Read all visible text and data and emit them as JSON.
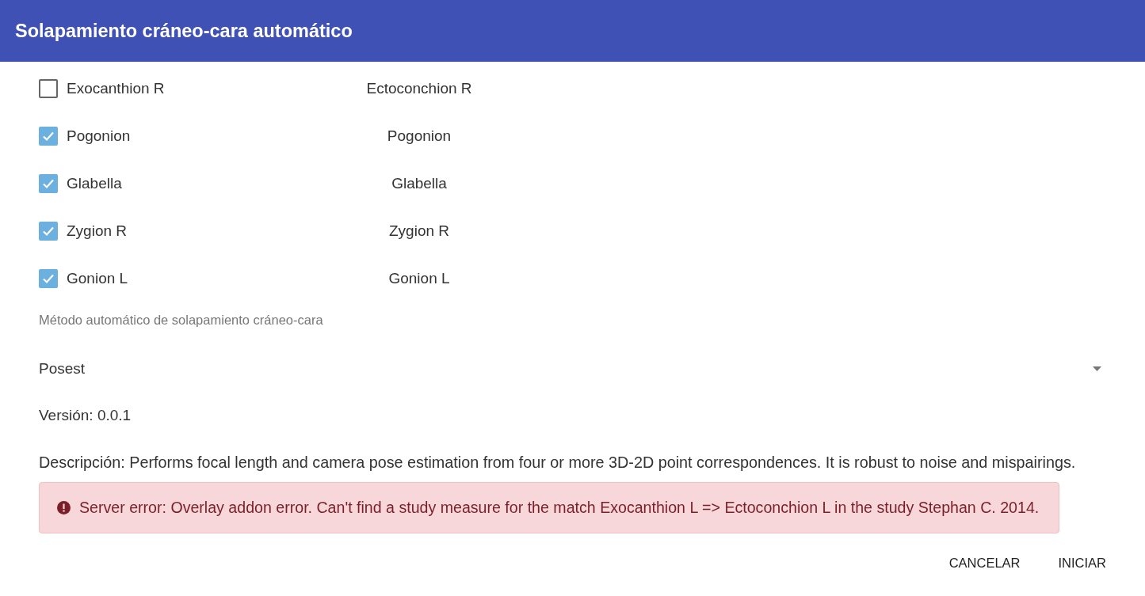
{
  "dialog": {
    "title": "Solapamiento cráneo-cara automático"
  },
  "pairs": [
    {
      "skull": "Exocanthion R",
      "face": "Ectoconchion R",
      "checked": false
    },
    {
      "skull": "Pogonion",
      "face": "Pogonion",
      "checked": true
    },
    {
      "skull": "Glabella",
      "face": "Glabella",
      "checked": true
    },
    {
      "skull": "Zygion R",
      "face": "Zygion R",
      "checked": true
    },
    {
      "skull": "Gonion L",
      "face": "Gonion L",
      "checked": true
    }
  ],
  "method": {
    "label": "Método automático de solapamiento cráneo-cara",
    "value": "Posest"
  },
  "version": "Versión: 0.0.1",
  "description": "Descripción: Performs focal length and camera pose estimation from four or more 3D-2D point correspondences. It is robust to noise and mispairings.",
  "error": "Server error: Overlay addon error. Can't find a study measure for the match Exocanthion L => Ectoconchion L in the study Stephan C. 2014.",
  "buttons": [
    "CANCELAR",
    "INICIAR"
  ]
}
